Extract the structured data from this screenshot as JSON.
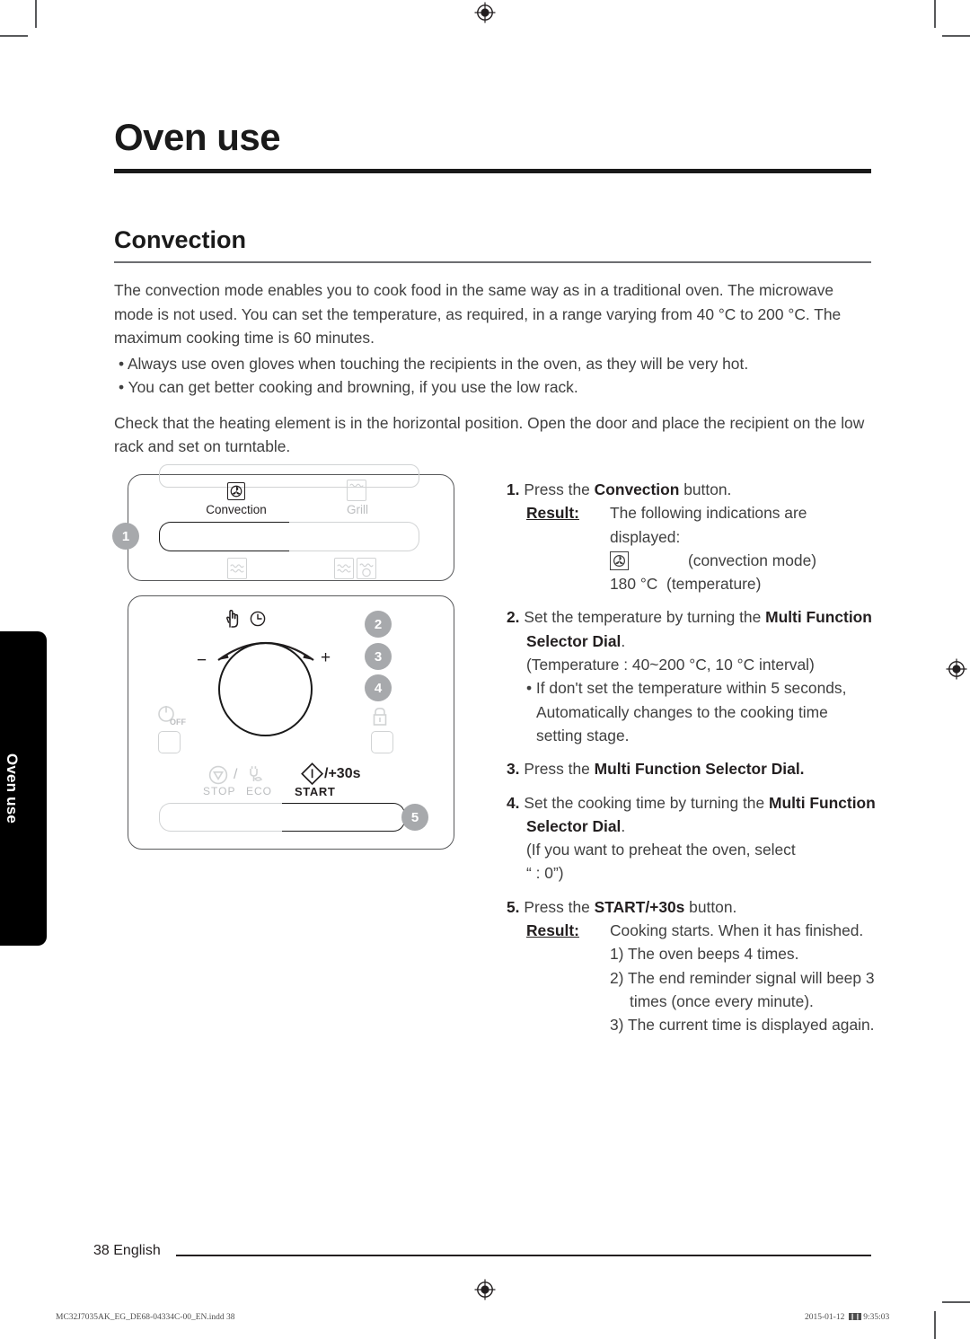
{
  "page": {
    "chapter_title": "Oven use",
    "section_title": "Convection",
    "side_tab_label": "Oven use",
    "folio": "38 English",
    "imprint_file": "MC32J7035AK_EG_DE68-04334C-00_EN.indd   38",
    "imprint_date": "2015-01-12",
    "imprint_time": "9:35:03",
    "imprint_glyph": "❙❙"
  },
  "intro": {
    "paragraph1": "The convection mode enables you to cook food in the same way as in a traditional oven. The microwave mode is not used. You can set the temperature, as required, in a range varying from 40 °C to 200 °C. The maximum cooking time is 60 minutes.",
    "bullet1": "• Always use oven gloves when touching the recipients in the oven, as they will be very hot.",
    "bullet2": "• You can get better cooking and browning, if you use the low rack.",
    "paragraph2": "Check that the heating element is in the horizontal position. Open the door and place the recipient on the low rack and set on turntable."
  },
  "steps": {
    "s1": {
      "num": "1.",
      "text_pre": "Press the ",
      "text_bold": "Convection",
      "text_post": " button.",
      "result_label": "Result:",
      "result_text": "The following indications are displayed:",
      "mode_icon_name": "convection-mode-icon",
      "mode_icon_caption": "(convection mode)",
      "temp_value": "180 °C",
      "temp_caption": "(temperature)"
    },
    "s2": {
      "num": "2.",
      "text_pre": "Set the temperature by turning the ",
      "text_bold": "Multi Function Selector Dial",
      "text_post": ".",
      "note": "(Temperature : 40~200 °C, 10 °C interval)",
      "bullet": "• If don't set the temperature within 5 seconds, Automatically changes to the cooking time setting stage."
    },
    "s3": {
      "num": "3.",
      "text_pre": "Press the ",
      "text_bold": "Multi Function Selector Dial.",
      "text_post": ""
    },
    "s4": {
      "num": "4.",
      "text_pre": "Set the cooking time by turning the ",
      "text_bold": "Multi Function Selector Dial",
      "text_post": ".",
      "note1": "(If you want to preheat the oven, select",
      "note2": "“ : 0”)"
    },
    "s5": {
      "num": "5.",
      "text_pre": "Press the ",
      "text_bold": "START/+30s",
      "text_post": " button.",
      "result_label": "Result:",
      "result_text": "Cooking starts. When it has finished.",
      "items": [
        "1) The oven beeps 4 times.",
        "2) The end reminder signal will beep 3 times (once every minute).",
        "3) The current time is displayed again."
      ]
    }
  },
  "panel_top": {
    "callout": "1",
    "label_convection": "Convection",
    "label_grill": "Grill"
  },
  "panel_main": {
    "callouts": [
      "2",
      "3",
      "4",
      "5"
    ],
    "dial_minus": "−",
    "dial_plus": "+",
    "label_off": "OFF",
    "label_stop": "STOP",
    "label_eco": "ECO",
    "label_start": "START",
    "label_start_plus": "/+30s",
    "label_slash": "/"
  },
  "colors": {
    "ink": "#231f20",
    "body": "#404040",
    "dim": "#bcbec0",
    "callout": "#a7a9ac",
    "tab": "#000000"
  }
}
